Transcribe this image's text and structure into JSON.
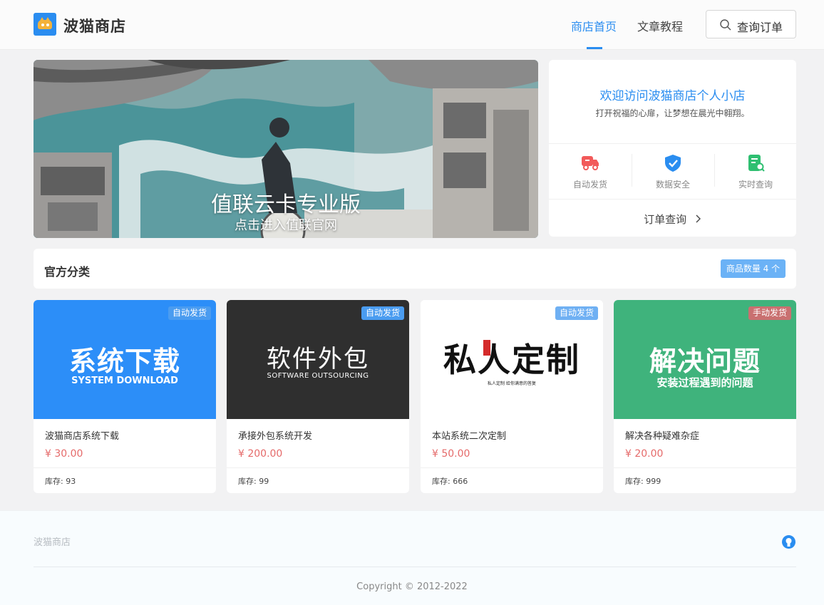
{
  "header": {
    "site_title": "波猫商店",
    "nav": [
      {
        "label": "商店首页",
        "active": true
      },
      {
        "label": "文章教程",
        "active": false
      }
    ],
    "order_button_label": "查询订单",
    "accent_color": "#2a8df0"
  },
  "banner": {
    "title": "值联云卡专业版",
    "subtitle": "点击进入值联官网"
  },
  "welcome": {
    "title": "欢迎访问波猫商店个人小店",
    "subtitle": "打开祝福的心扉，让梦想在晨光中翱翔。",
    "features": [
      {
        "icon": "truck-icon",
        "label": "自动发货",
        "color": "#f25a5a"
      },
      {
        "icon": "shield-check-icon",
        "label": "数据安全",
        "color": "#2a8df0"
      },
      {
        "icon": "document-search-icon",
        "label": "实时查询",
        "color": "#2fbf71"
      }
    ],
    "order_query_label": "订单查询"
  },
  "category": {
    "title": "官方分类",
    "count_badge": "商品数量 4 个"
  },
  "products": [
    {
      "name": "波猫商店系统下载",
      "price": "¥ 30.00",
      "stock_label": "库存:",
      "stock": "93",
      "tag": "自动发货",
      "img_title": "系统下载",
      "img_sub": "SYSTEM DOWNLOAD"
    },
    {
      "name": "承接外包系统开发",
      "price": "¥ 200.00",
      "stock_label": "库存:",
      "stock": "99",
      "tag": "自动发货",
      "img_title": "软件外包",
      "img_sub": "SOFTWARE OUTSOURCING"
    },
    {
      "name": "本站系统二次定制",
      "price": "¥ 50.00",
      "stock_label": "库存:",
      "stock": "666",
      "tag": "自动发货",
      "img_title": "私人定制",
      "img_sub": "私人定制    给你满意的答复"
    },
    {
      "name": "解决各种疑难杂症",
      "price": "¥ 20.00",
      "stock_label": "库存:",
      "stock": "999",
      "tag": "手动发货",
      "img_title": "解决问题",
      "img_sub": "安装过程遇到的问题"
    }
  ],
  "footer": {
    "brand": "波猫商店",
    "copyright": "Copyright © 2012-2022"
  }
}
